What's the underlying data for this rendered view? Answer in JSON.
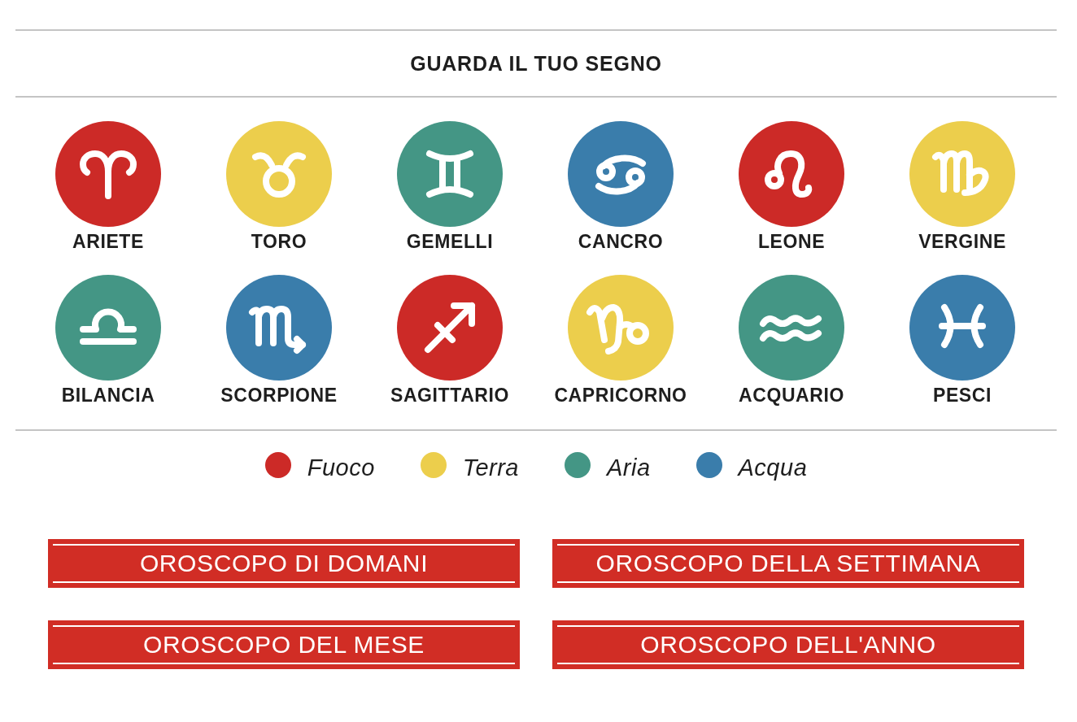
{
  "heading": "GUARDA IL TUO SEGNO",
  "signs": [
    {
      "name": "ARIETE",
      "kind": "aries",
      "color": "#cc2a27"
    },
    {
      "name": "TORO",
      "kind": "taurus",
      "color": "#ecce4c"
    },
    {
      "name": "GEMELLI",
      "kind": "gemini",
      "color": "#449685"
    },
    {
      "name": "CANCRO",
      "kind": "cancer",
      "color": "#3a7dab"
    },
    {
      "name": "LEONE",
      "kind": "leo",
      "color": "#cc2a27"
    },
    {
      "name": "VERGINE",
      "kind": "virgo",
      "color": "#ecce4c"
    },
    {
      "name": "BILANCIA",
      "kind": "libra",
      "color": "#449685"
    },
    {
      "name": "SCORPIONE",
      "kind": "scorpio",
      "color": "#3a7dab"
    },
    {
      "name": "SAGITTARIO",
      "kind": "sagittarius",
      "color": "#cc2a27"
    },
    {
      "name": "CAPRICORNO",
      "kind": "capricorn",
      "color": "#ecce4c"
    },
    {
      "name": "ACQUARIO",
      "kind": "aquarius",
      "color": "#449685"
    },
    {
      "name": "PESCI",
      "kind": "pisces",
      "color": "#3a7dab"
    }
  ],
  "legend": [
    {
      "label": "Fuoco",
      "color": "#cc2a27"
    },
    {
      "label": "Terra",
      "color": "#ecce4c"
    },
    {
      "label": "Aria",
      "color": "#449685"
    },
    {
      "label": "Acqua",
      "color": "#3a7dab"
    }
  ],
  "buttons": [
    "OROSCOPO DI DOMANI",
    "OROSCOPO DELLA SETTIMANA",
    "OROSCOPO DEL MESE",
    "OROSCOPO DELL'ANNO"
  ]
}
